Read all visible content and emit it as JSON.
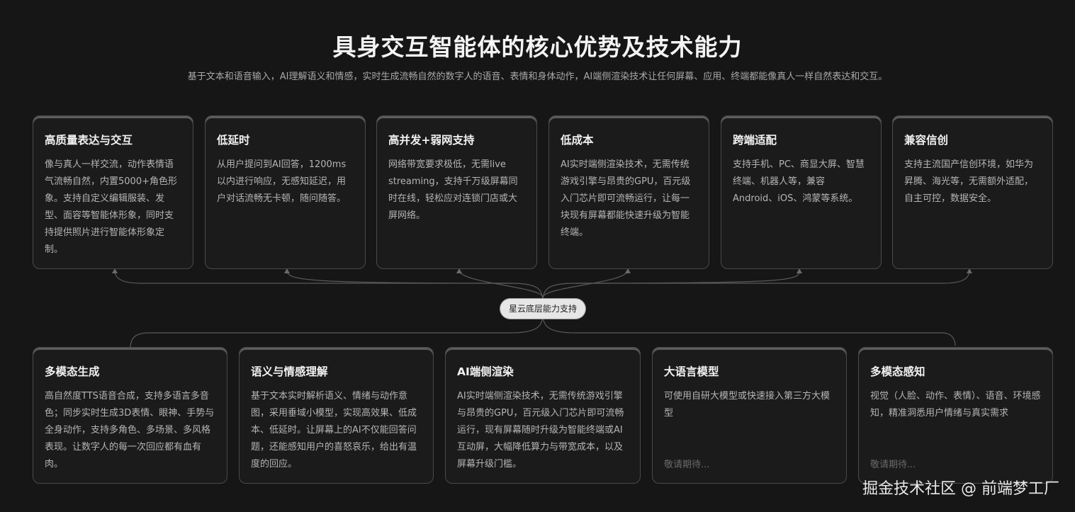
{
  "header": {
    "title": "具身交互智能体的核心优势及技术能力",
    "subtitle": "基于文本和语音输入，AI理解语义和情感，实时生成流畅自然的数字人的语音、表情和身体动作，AI端侧渲染技术让任何屏幕、应用、终端都能像真人一样自然表达和交互。"
  },
  "top_cards": [
    {
      "title": "高质量表达与交互",
      "text": "像与真人一样交流，动作表情语气流畅自然，内置5000+角色形象。支持自定义编辑服装、发型、面容等智能体形象，同时支持提供照片进行智能体形象定制。"
    },
    {
      "title": "低延时",
      "text": "从用户提问到AI回答，1200ms以内进行响应，无感知延迟，用户对话流畅无卡顿，随问随答。"
    },
    {
      "title": "高并发+弱网支持",
      "text": "网络带宽要求极低，无需live streaming，支持千万级屏幕同时在线，轻松应对连锁门店或大屏网络。"
    },
    {
      "title": "低成本",
      "text": "AI实时端侧渲染技术，无需传统游戏引擎与昂贵的GPU，百元级入门芯片即可流畅运行，让每一块现有屏幕都能快速升级为智能终端。"
    },
    {
      "title": "跨端适配",
      "text": "支持手机、PC、商显大屏、智慧终端、机器人等，兼容Android、iOS、鸿蒙等系统。"
    },
    {
      "title": "兼容信创",
      "text": "支持主流国产信创环境，如华为昇腾、海光等，无需额外适配，自主可控，数据安全。"
    }
  ],
  "center_label": "星云底层能力支持",
  "bottom_cards": [
    {
      "title": "多模态生成",
      "text": "高自然度TTS语音合成，支持多语言多音色；同步实时生成3D表情、眼神、手势与全身动作，支持多角色、多场景、多风格表现。让数字人的每一次回应都有血有肉。",
      "soon": ""
    },
    {
      "title": "语义与情感理解",
      "text": "基于文本实时解析语义、情绪与动作意图，采用垂域小模型，实现高效果、低成本、低延时。让屏幕上的AI不仅能回答问题，还能感知用户的喜怒哀乐，给出有温度的回应。",
      "soon": ""
    },
    {
      "title": "AI端侧渲染",
      "text": "AI实时端侧渲染技术，无需传统游戏引擎与昂贵的GPU，百元级入门芯片即可流畅运行，现有屏幕随时升级为智能终端或AI互动屏，大幅降低算力与带宽成本，以及屏幕升级门槛。",
      "soon": ""
    },
    {
      "title": "大语言模型",
      "text": "可使用自研大模型或快速接入第三方大模型",
      "soon": "敬请期待..."
    },
    {
      "title": "多模态感知",
      "text": "视觉（人脸、动作、表情）、语音、环境感知，精准洞悉用户情绪与真实需求",
      "soon": "敬请期待..."
    }
  ],
  "watermark": "掘金技术社区 @ 前端梦工厂"
}
